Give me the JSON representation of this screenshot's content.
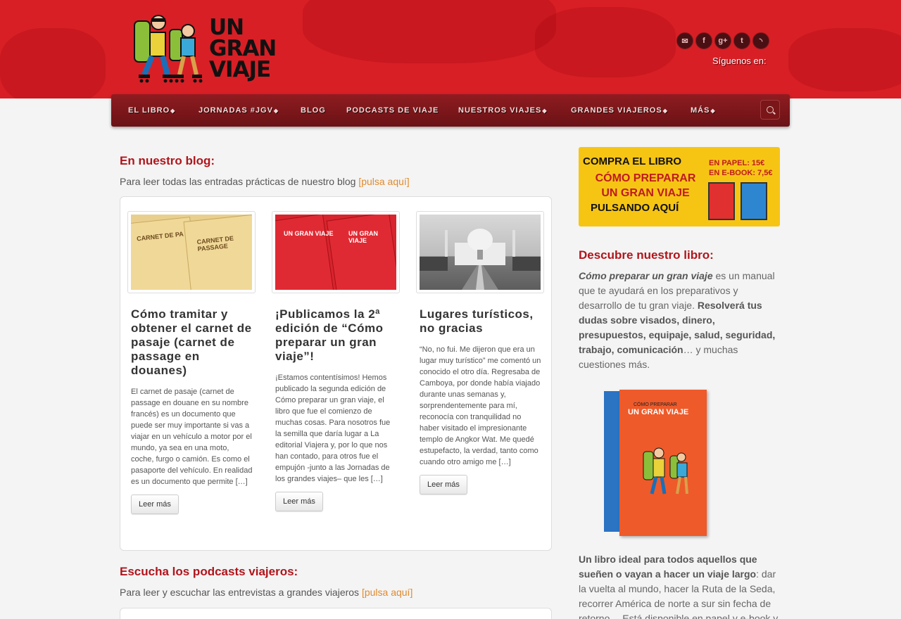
{
  "header": {
    "logo_text": [
      "UN",
      "GRAN",
      "VIAJE"
    ],
    "social_icons": [
      "email-icon",
      "facebook-icon",
      "google-plus-icon",
      "twitter-icon",
      "rss-icon"
    ],
    "follow_label": "Síguenos en:",
    "brand_color": "#d81f26"
  },
  "nav": {
    "items": [
      {
        "label": "EL LIBRO",
        "dropdown": true
      },
      {
        "label": "JORNADAS #JGV",
        "dropdown": true
      },
      {
        "label": "BLOG",
        "dropdown": false
      },
      {
        "label": "PODCASTS DE VIAJE",
        "dropdown": false
      },
      {
        "label": "NUESTROS VIAJES",
        "dropdown": true
      },
      {
        "label": "GRANDES VIAJEROS",
        "dropdown": true
      },
      {
        "label": "MÁS",
        "dropdown": true
      }
    ],
    "search_icon": "search-icon"
  },
  "blog_section": {
    "title": "En nuestro blog:",
    "intro": "Para leer todas las entradas prácticas de nuestro blog ",
    "link": "[pulsa aquí]"
  },
  "posts": [
    {
      "title": "Cómo tramitar y obtener el carnet de pasaje (carnet de passage en douanes)",
      "excerpt": "El carnet de pasaje (carnet de passage en douane en su nombre francés) es un documento que puede ser muy importante si vas a viajar en un vehículo a motor por el mundo, ya sea en una moto, coche, furgo o camión. Es como el pasaporte del vehículo. En realidad es un documento que permite […]",
      "button": "Leer más",
      "image_labels": [
        "CARNET DE PA",
        "CARNET DE PASSAGE"
      ]
    },
    {
      "title": "¡Publicamos la 2ª edición de “Cómo preparar un gran viaje”!",
      "excerpt": "¡Estamos contentísimos! Hemos publicado la segunda edición de Cómo preparar un gran viaje, el libro que fue el comienzo de muchas cosas. Para nosotros fue la semilla que daría lugar a La editorial Viajera y, por lo que nos han contado, para otros fue el empujón -junto a las Jornadas de los grandes viajes– que les […]",
      "button": "Leer más",
      "image_labels": [
        "UN GRAN VIAJE",
        "UN GRAN VIAJE"
      ]
    },
    {
      "title": "Lugares turísticos, no gracias",
      "excerpt": "“No, no fui. Me dijeron que era un lugar muy turístico” me comentó un conocido el otro día. Regresaba de Camboya, por donde había viajado durante unas semanas y, sorprendentemente para mí, reconocía con tranquilidad no haber visitado el impresionante templo de Angkor Wat. Me quedé estupefacto, la verdad, tanto como cuando otro amigo me […]",
      "button": "Leer más"
    }
  ],
  "podcast_section": {
    "title": "Escucha los podcasts viajeros:",
    "intro": "Para leer y escuchar las entrevistas a grandes viajeros ",
    "link": "[pulsa aquí]"
  },
  "sidebar": {
    "banner": {
      "line1": "COMPRA EL LIBRO",
      "line2": "CÓMO PREPARAR UN GRAN VIAJE",
      "line3": "PULSANDO AQUÍ",
      "price_paper": "EN PAPEL:   15€",
      "price_ebook": "EN E-BOOK: 7,5€"
    },
    "book_title": "Descubre nuestro libro:",
    "para1_italic": "Cómo preparar un gran viaje",
    "para1_a": " es un manual que te ayudará en los preparativos y desarrollo de tu gran viaje. ",
    "para1_bold": "Resolverá tus dudas sobre visados, dinero, presupuestos, equipaje, salud, seguridad, trabajo, comunicación",
    "para1_b": "… y muchas cuestiones más.",
    "cover_small": "CÓMO PREPARAR",
    "cover_big": "UN GRAN VIAJE",
    "para2_bold": "Un libro ideal para todos aquellos que sueñen o vayan a hacer un viaje largo",
    "para2_rest": ": dar la vuelta al mundo, hacer la Ruta de la Seda, recorrer América de norte a sur sin fecha de retorno… Está disponible en papel y e-book y"
  }
}
